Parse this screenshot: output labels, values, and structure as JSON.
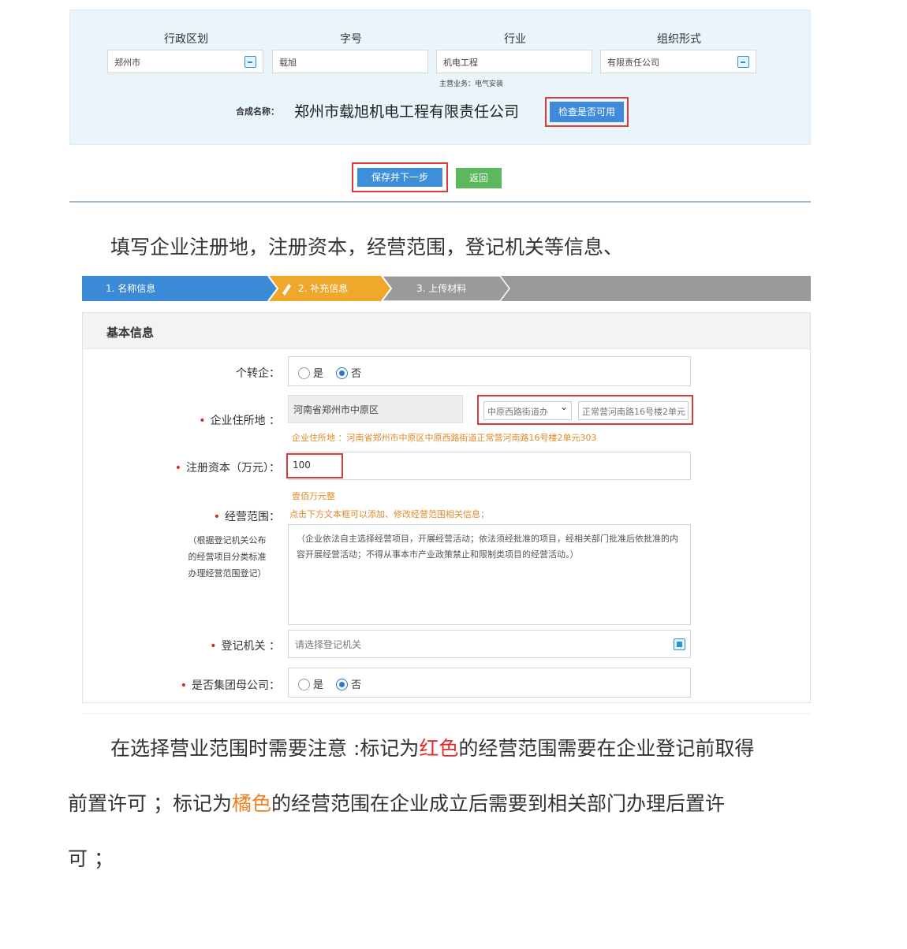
{
  "name_panel": {
    "fields": [
      {
        "label": "行政区划",
        "value": "郑州市",
        "has_picker": true
      },
      {
        "label": "字号",
        "value": "载旭",
        "has_picker": false
      },
      {
        "label": "行业",
        "value": "机电工程",
        "has_picker": false
      },
      {
        "label": "组织形式",
        "value": "有限责任公司",
        "has_picker": true
      }
    ],
    "main_business": "主营业务：电气安装",
    "combined_label": "合成名称：",
    "combined_value": "郑州市载旭机电工程有限责任公司",
    "check_button": "检查是否可用"
  },
  "actions": {
    "save_button": "保存并下一步",
    "back_button": "返回"
  },
  "instruction": "填写企业注册地，注册资本，经营范围，登记机关等信息、",
  "stepper": {
    "steps": [
      {
        "label": "1. 名称信息",
        "color": "#3a8ad8"
      },
      {
        "label": "2. 补充信息",
        "color": "#f0a82c"
      },
      {
        "label": "3. 上传材料",
        "color": "#9a9a9a"
      }
    ]
  },
  "form": {
    "section_title": "基本信息",
    "individual_to_enterprise": {
      "label": "个转企：",
      "options": [
        {
          "label": "是",
          "checked": false
        },
        {
          "label": "否",
          "checked": true
        }
      ]
    },
    "address": {
      "label": "企业住所地 ：",
      "region": "河南省郑州市中原区",
      "street_select": "中原西路街道办",
      "detail": "正常营河南路16号楼2单元",
      "hint": "企业住所地 ：河南省郑州市中原区中原西路街道正常营河南路16号楼2单元303"
    },
    "capital": {
      "label": "注册资本（万元）：",
      "value": "100",
      "hint": "壹佰万元整"
    },
    "business_scope": {
      "label": "经营范围：",
      "hint": "点击下方文本框可以添加、修改经营范围相关信息；",
      "note_lines": [
        "（根据登记机关公布",
        "的经营项目分类标准",
        "办理经营范围登记）"
      ],
      "text": "（企业依法自主选择经营项目，开展经营活动；依法须经批准的项目，经相关部门批准后依批准的内容开展经营活动；不得从事本市产业政策禁止和限制类项目的经营活动。）"
    },
    "registration_authority": {
      "label": "登记机关 ：",
      "placeholder": "请选择登记机关"
    },
    "group_parent": {
      "label": "是否集团母公司：",
      "options": [
        {
          "label": "是",
          "checked": false
        },
        {
          "label": "否",
          "checked": true
        }
      ]
    }
  },
  "note_paragraph": {
    "line1_a": "在选择营业范围时需要注意 :标记为",
    "line1_red": "红色",
    "line1_b": "的经营范围需要在企业登记前取得",
    "line2_a": "前置许可 ；标记为",
    "line2_orange": "橘色",
    "line2_b": "的经营范围在企业成立后需要到相关部门办理后置许",
    "line3": "可 ；"
  }
}
